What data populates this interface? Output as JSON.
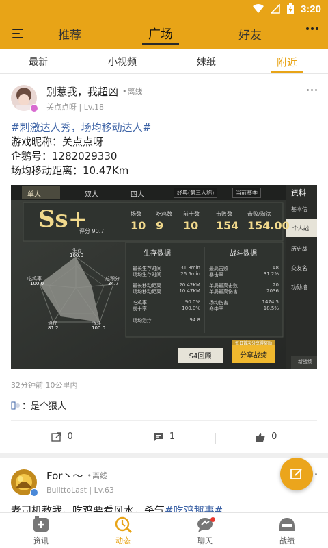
{
  "status_bar": {
    "time": "3:20"
  },
  "top_nav": {
    "tabs": [
      "推荐",
      "广场",
      "好友"
    ],
    "active": "广场"
  },
  "sub_tabs": {
    "tabs": [
      "最新",
      "小视频",
      "妹纸",
      "附近"
    ],
    "active": "附近"
  },
  "posts": [
    {
      "author": "别惹我，我超凶",
      "status": "离线",
      "subtitle": "关点点呀 | Lv.18",
      "hashtag": "#刺激达人秀，场均移动达人#",
      "lines": [
        "游戏昵称：关点点呀",
        "企鹅号：1282029330",
        "场均移动距离：10.47Km"
      ],
      "meta": "32分钟前  10公里内",
      "comment": "：是个狠人",
      "actions": {
        "share": "0",
        "comments": "1",
        "likes": "0"
      },
      "screenshot": {
        "tabs": [
          "单人",
          "双人",
          "四人"
        ],
        "mode_select": "经典(第三人称)",
        "season_select": "当前赛季",
        "right_title": "资料",
        "right_menu": [
          "基本信",
          "个人战",
          "历史战",
          "交友名",
          "功勋墙"
        ],
        "rank": "Ss+",
        "score_label": "评分 90.7",
        "stats_headers": [
          "场数",
          "吃鸡数",
          "前十数",
          "击败数",
          "击败/淘汰"
        ],
        "stats_values": [
          "10",
          "9",
          "10",
          "154",
          "154.00"
        ],
        "radar_labels": {
          "top": "生存",
          "top_value": "100.0",
          "right": "总积分",
          "right_value": "34.7",
          "left": "吃鸡率",
          "left_value": "100.0",
          "bl": "治疗",
          "bl_value": "81.2",
          "br": "战斗",
          "br_value": "100.0"
        },
        "survival_title": "生存数据",
        "survival_rows": [
          [
            "最长生存时间",
            "31.3min"
          ],
          [
            "场均生存时间",
            "26.5min"
          ],
          [
            "最长移动距离",
            "20.42KM"
          ],
          [
            "场均移动距离",
            "10.47KM"
          ],
          [
            "吃鸡率",
            "90.0%"
          ],
          [
            "前十率",
            "100.0%"
          ],
          [
            "场均治疗",
            "94.8"
          ]
        ],
        "combat_title": "战斗数据",
        "combat_rows": [
          [
            "最高击败",
            "48"
          ],
          [
            "暴击率",
            "31.2%"
          ],
          [
            "单局最高击败",
            "20"
          ],
          [
            "单局最高伤害",
            "2036"
          ],
          [
            "场均伤害",
            "1474.5"
          ],
          [
            "命中率",
            "18.5%"
          ]
        ],
        "season_button": "S4回顾",
        "share_button": "分享战绩",
        "share_hint": "每日首次分享得奖励",
        "corner_text": "新战绩"
      }
    },
    {
      "author": "For丶～",
      "status": "离线",
      "subtitle": "BuilttoLast | Lv.63",
      "text_prefix": "老司机教我，吃鸡要看风水，杀气",
      "hashtag": "#吃鸡趣事#"
    }
  ],
  "tab_bar": {
    "items": [
      "资讯",
      "动态",
      "聊天",
      "战绩"
    ],
    "active": "动态"
  },
  "colors": {
    "brand": "#e8a417",
    "hashtag": "#3d63a6",
    "notification": "#e8382f"
  }
}
